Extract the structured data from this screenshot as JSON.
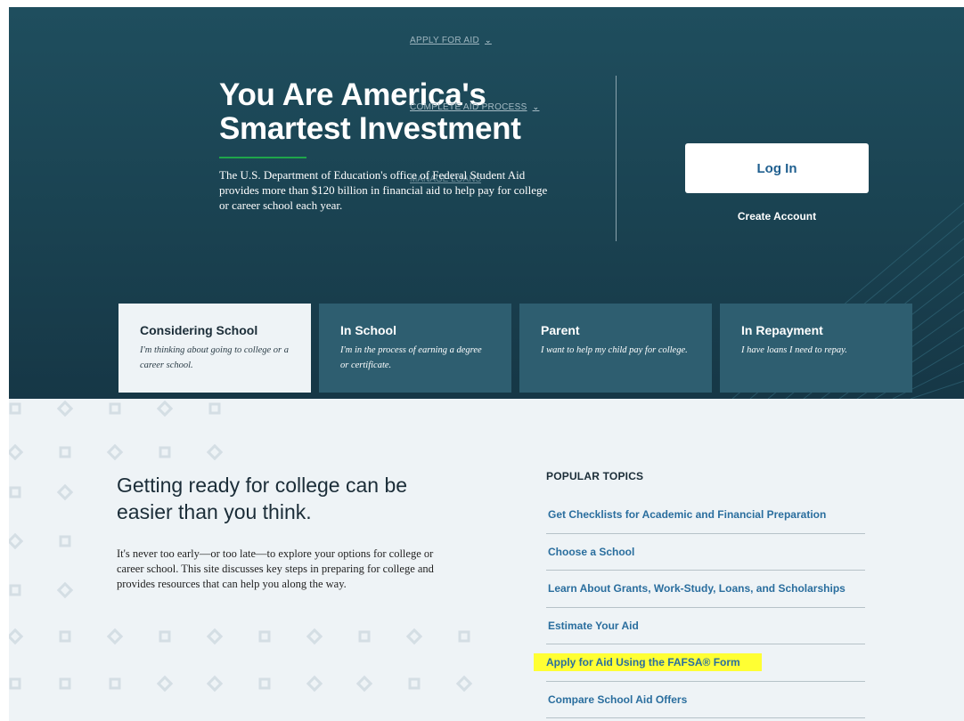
{
  "nav": {
    "apply_for_aid": "APPLY FOR AID",
    "complete_aid_process": "COMPLETE AID PROCESS",
    "ghost_item": "MANAGE LOANS"
  },
  "hero": {
    "title": "You Are America's Smartest Investment",
    "description": "The U.S. Department of Education's office of Federal Student Aid provides more than $120 billion in financial aid to help pay for college or career school each year.",
    "login_label": "Log In",
    "create_account_label": "Create Account"
  },
  "tabs": [
    {
      "title": "Considering School",
      "desc": "I'm thinking about going to college or a career school.",
      "active": true
    },
    {
      "title": "In School",
      "desc": "I'm in the process of earning a degree or certificate.",
      "active": false
    },
    {
      "title": "Parent",
      "desc": "I want to help my child pay for college.",
      "active": false
    },
    {
      "title": "In Repayment",
      "desc": "I have loans I need to repay.",
      "active": false
    }
  ],
  "content": {
    "heading": "Getting ready for college can be easier than you think.",
    "body": "It's never too early—or too late—to explore your options for college or career school. This site discusses key steps in preparing for college and provides resources that can help you along the way."
  },
  "popular_topics": {
    "heading": "POPULAR TOPICS",
    "items": [
      "Get Checklists for Academic and Financial Preparation",
      "Choose a School",
      "Learn About Grants, Work-Study, Loans, and Scholarships",
      "Estimate Your Aid",
      "Apply for Aid Using the FAFSA® Form",
      "Compare School Aid Offers"
    ]
  },
  "colors": {
    "hero_bg": "#1f4e5e",
    "tab_bg": "#2e5e70",
    "accent_green": "#1fa64a",
    "link_blue": "#2a6e9e",
    "highlight": "#ffff33"
  }
}
